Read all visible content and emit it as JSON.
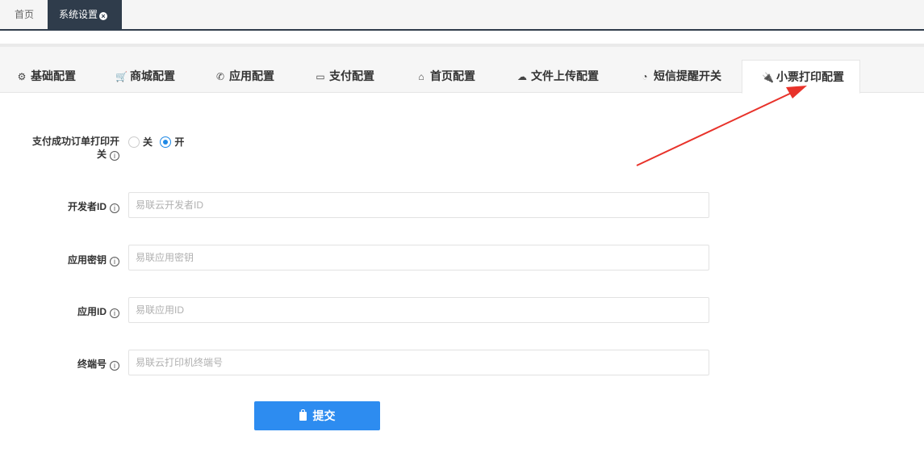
{
  "page_tabs": [
    {
      "label": "首页"
    },
    {
      "label": "系统设置"
    }
  ],
  "config_tabs": [
    {
      "label": "基础配置",
      "icon": "gear-icon"
    },
    {
      "label": "商城配置",
      "icon": "cart-icon"
    },
    {
      "label": "应用配置",
      "icon": "whatsapp-icon"
    },
    {
      "label": "支付配置",
      "icon": "credit-card-icon"
    },
    {
      "label": "首页配置",
      "icon": "home-icon"
    },
    {
      "label": "文件上传配置",
      "icon": "cloud-upload-icon"
    },
    {
      "label": "短信提醒开关",
      "icon": "rss-icon"
    },
    {
      "label": "小票打印配置",
      "icon": "plug-icon",
      "active": true
    }
  ],
  "form": {
    "print_switch": {
      "label_line1": "支付成功订单打印开",
      "label_line2": "关",
      "options": [
        "关",
        "开"
      ],
      "selected": "开"
    },
    "developer_id": {
      "label": "开发者ID",
      "placeholder": "易联云开发者ID",
      "value": ""
    },
    "app_secret": {
      "label": "应用密钥",
      "placeholder": "易联应用密钥",
      "value": ""
    },
    "app_id": {
      "label": "应用ID",
      "placeholder": "易联应用ID",
      "value": ""
    },
    "terminal_no": {
      "label": "终端号",
      "placeholder": "易联云打印机终端号",
      "value": ""
    },
    "submit_label": "提交"
  },
  "colors": {
    "primary": "#2d8cf0",
    "dark_tab": "#2f3c4b",
    "arrow": "#e8322a"
  }
}
